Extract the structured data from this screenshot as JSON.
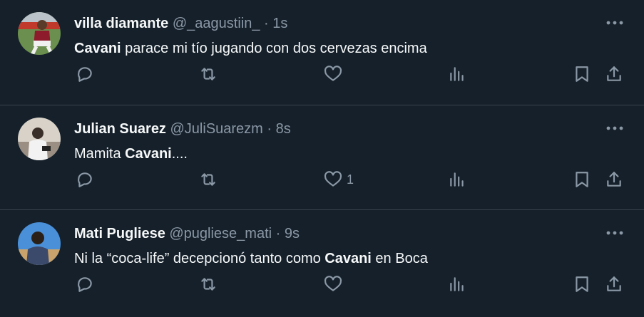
{
  "tweets": [
    {
      "name": "villa diamante",
      "handle": "@_aagustiin_",
      "dot": "·",
      "time": "1s",
      "text_parts": [
        "",
        "Cavani",
        " parace mi tío jugando con dos cervezas encima"
      ],
      "like_count": ""
    },
    {
      "name": "Julian Suarez",
      "handle": "@JuliSuarezm",
      "dot": "·",
      "time": "8s",
      "text_parts": [
        "Mamita ",
        "Cavani",
        "...."
      ],
      "like_count": "1"
    },
    {
      "name": "Mati Pugliese",
      "handle": "@pugliese_mati",
      "dot": "·",
      "time": "9s",
      "text_parts": [
        "Ni la “coca-life” decepcionó tanto como ",
        "Cavani",
        " en Boca"
      ],
      "like_count": ""
    }
  ],
  "icons": {
    "more": "more-horizontal-icon",
    "reply": "reply-icon",
    "retweet": "retweet-icon",
    "like": "heart-icon",
    "views": "views-chart-icon",
    "bookmark": "bookmark-icon",
    "share": "share-icon"
  },
  "colors": {
    "background": "#15202b",
    "text": "#f7f9f9",
    "muted": "#8b98a5",
    "divider": "#38444d"
  }
}
